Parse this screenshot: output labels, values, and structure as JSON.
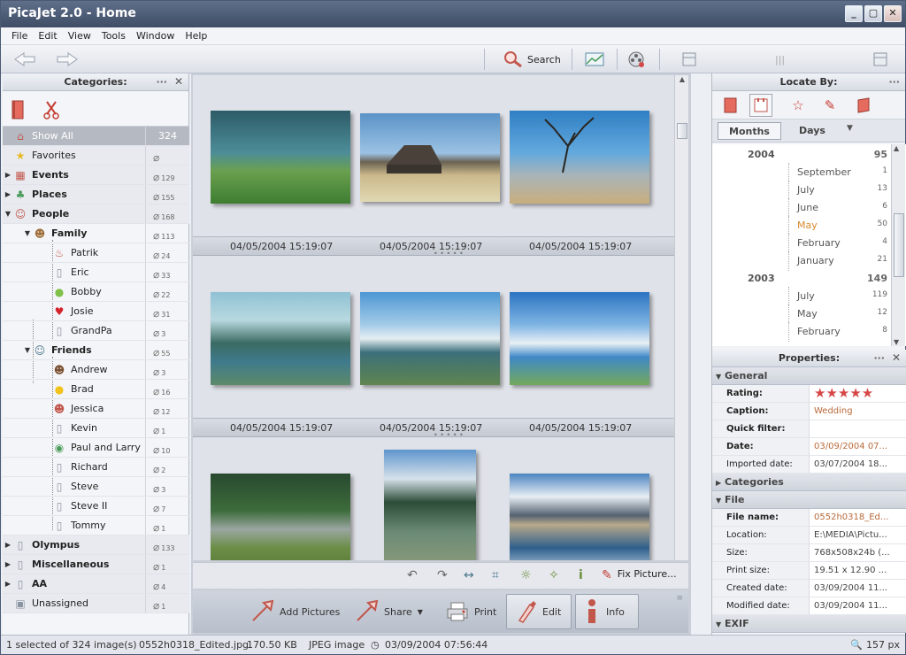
{
  "window": {
    "title": "PicaJet 2.0 - Home"
  },
  "menu": [
    "File",
    "Edit",
    "View",
    "Tools",
    "Window",
    "Help"
  ],
  "toolbar": {
    "search_label": "Search"
  },
  "categories_panel": {
    "title": "Categories:",
    "items": [
      {
        "label": "Show All",
        "count": "324",
        "icon": "home-icon"
      },
      {
        "label": "Favorites",
        "count": "",
        "icon": "star-icon"
      },
      {
        "label": "Events",
        "count": "129",
        "icon": "calendar-icon"
      },
      {
        "label": "Places",
        "count": "155",
        "icon": "palm-icon"
      },
      {
        "label": "People",
        "count": "168",
        "icon": "people-icon"
      },
      {
        "label": "Family",
        "count": "113",
        "icon": "family-icon"
      },
      {
        "label": "Patrik",
        "count": "24",
        "icon": "cake-icon"
      },
      {
        "label": "Eric",
        "count": "33",
        "icon": "blank-icon"
      },
      {
        "label": "Bobby",
        "count": "22",
        "icon": "ball-icon"
      },
      {
        "label": "Josie",
        "count": "31",
        "icon": "heart-icon"
      },
      {
        "label": "GrandPa",
        "count": "3",
        "icon": "blank-icon"
      },
      {
        "label": "Friends",
        "count": "55",
        "icon": "friends-icon"
      },
      {
        "label": "Andrew",
        "count": "3",
        "icon": "person-icon"
      },
      {
        "label": "Brad",
        "count": "16",
        "icon": "yellow-ball-icon"
      },
      {
        "label": "Jessica",
        "count": "12",
        "icon": "person-female-icon"
      },
      {
        "label": "Kevin",
        "count": "1",
        "icon": "blank-icon"
      },
      {
        "label": "Paul and Larry",
        "count": "10",
        "icon": "soccer-icon"
      },
      {
        "label": "Richard",
        "count": "2",
        "icon": "blank-icon"
      },
      {
        "label": "Steve",
        "count": "3",
        "icon": "blank-icon"
      },
      {
        "label": "Steve II",
        "count": "7",
        "icon": "blank-icon"
      },
      {
        "label": "Tommy",
        "count": "1",
        "icon": "blank-icon"
      },
      {
        "label": "Olympus",
        "count": "133",
        "icon": "blank-icon"
      },
      {
        "label": "Miscellaneous",
        "count": "1",
        "icon": "blank-icon"
      },
      {
        "label": "AA",
        "count": "4",
        "icon": "blank-icon"
      },
      {
        "label": "Unassigned",
        "count": "1",
        "icon": "box-icon"
      }
    ]
  },
  "grid": {
    "dates": [
      "04/05/2004 15:19:07",
      "04/05/2004 15:19:07",
      "04/05/2004 15:19:07",
      "04/05/2004 15:19:07",
      "04/05/2004 15:19:07",
      "04/05/2004 15:19:07"
    ],
    "fix_picture_label": "Fix Picture...",
    "add_pictures_label": "Add Pictures",
    "share_label": "Share",
    "print_label": "Print",
    "edit_label": "Edit",
    "info_label": "Info"
  },
  "locate": {
    "title": "Locate By:",
    "tab_months": "Months",
    "tab_days": "Days",
    "timeline": [
      {
        "year": "2004",
        "count": "95"
      },
      {
        "month": "September",
        "count": "1"
      },
      {
        "month": "July",
        "count": "13"
      },
      {
        "month": "June",
        "count": "6"
      },
      {
        "month": "May",
        "count": "50",
        "highlight": true
      },
      {
        "month": "February",
        "count": "4"
      },
      {
        "month": "January",
        "count": "21"
      },
      {
        "year": "2003",
        "count": "149"
      },
      {
        "month": "July",
        "count": "119"
      },
      {
        "month": "May",
        "count": "12"
      },
      {
        "month": "February",
        "count": "8"
      }
    ]
  },
  "properties": {
    "title": "Properties:",
    "general": "General",
    "rating_label": "Rating:",
    "rating": 5,
    "caption_label": "Caption:",
    "caption": "Wedding",
    "quick_filter_label": "Quick filter:",
    "date_label": "Date:",
    "date": "03/09/2004 07...",
    "imported_label": "Imported date:",
    "imported": "03/07/2004 18...",
    "categories": "Categories",
    "file": "File",
    "file_name_label": "File name:",
    "file_name": "0552h0318_Ed...",
    "location_label": "Location:",
    "location": "E:\\MEDIA\\Pictu...",
    "size_label": "Size:",
    "size": "768x508x24b (...",
    "print_size_label": "Print size:",
    "print_size": "19.51 x 12.90 ...",
    "created_label": "Created date:",
    "created": "03/09/2004 11...",
    "modified_label": "Modified date:",
    "modified": "03/09/2004 11...",
    "exif": "EXIF"
  },
  "status": {
    "selection": "1 selected of 324 image(s)",
    "file": "0552h0318_Edited.jpg",
    "size": "170.50 KB",
    "type": "JPEG image",
    "date": "03/09/2004 07:56:44",
    "zoom": "157 px"
  },
  "colors": {
    "accent": "#d64747",
    "title_bar": "#4a5872",
    "selected_row": "#b5b9c2"
  }
}
